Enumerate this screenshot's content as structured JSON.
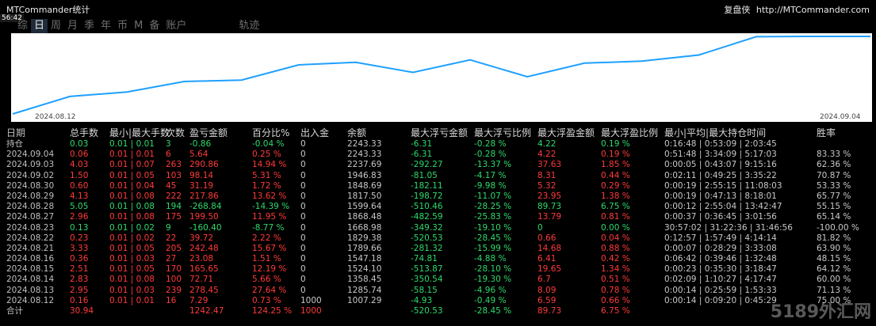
{
  "app_title": "MTCommander统计",
  "brand_name": "复盘侠",
  "brand_url": "http://MTCommander.com",
  "clock": "56:42",
  "tabs": [
    "综",
    "日",
    "周",
    "月",
    "季",
    "年",
    "币",
    "M",
    "备",
    "账户",
    "轨迹"
  ],
  "active_tab": "日",
  "chart": {
    "x_start_label": "2024.08.12",
    "x_end_label": "2024.09.04",
    "line_color": "#1fa0ff",
    "balances": [
      1007.29,
      1285.74,
      1358.45,
      1524.1,
      1547.18,
      1789.66,
      1829.38,
      1668.98,
      1868.48,
      1599.64,
      1817.5,
      1848.69,
      1946.83,
      2237.69,
      2243.33,
      2243.33
    ]
  },
  "table": {
    "headers": [
      "日期",
      "总手数",
      "最小|最大手数",
      "次数",
      "盈亏金额",
      "百分比%",
      "出入金",
      "余额",
      "最大浮亏金额",
      "最大浮亏比例",
      "最大浮盈金额",
      "最大浮盈比例",
      "最小|平均|最大持仓时间",
      "胜率"
    ],
    "rows": [
      {
        "date": "持仓",
        "total": "0.03",
        "minmax": "0.01 | 0.01",
        "count": "3",
        "pl": "-0.86",
        "pct": "-0.04 %",
        "io": "0",
        "bal": "2243.33",
        "mfl": "-6.31",
        "mflp": "-0.28 %",
        "mfp": "4.22",
        "mfpp": "0.19 %",
        "hold": "0:16:48 | 0:53:09 | 2:03:45",
        "win": "",
        "cls": "g"
      },
      {
        "date": "2024.09.04",
        "total": "0.06",
        "minmax": "0.01 | 0.01",
        "count": "6",
        "pl": "5.64",
        "pct": "0.25 %",
        "io": "0",
        "bal": "2243.33",
        "mfl": "-6.31",
        "mflp": "-0.28 %",
        "mfp": "4.22",
        "mfpp": "0.19 %",
        "hold": "0:51:48 | 3:34:09 | 5:17:03",
        "win": "83.33 %",
        "cls": "r"
      },
      {
        "date": "2024.09.03",
        "total": "4.03",
        "minmax": "0.01 | 0.07",
        "count": "263",
        "pl": "290.86",
        "pct": "14.94 %",
        "io": "0",
        "bal": "2237.69",
        "mfl": "-292.27",
        "mflp": "-13.37 %",
        "mfp": "37.63",
        "mfpp": "1.85 %",
        "hold": "0:00:05 | 0:43:07 | 9:15:16",
        "win": "62.36 %",
        "cls": "r"
      },
      {
        "date": "2024.09.02",
        "total": "1.50",
        "minmax": "0.01 | 0.05",
        "count": "103",
        "pl": "98.14",
        "pct": "5.31 %",
        "io": "0",
        "bal": "1946.83",
        "mfl": "-81.05",
        "mflp": "-4.17 %",
        "mfp": "8.31",
        "mfpp": "0.44 %",
        "hold": "0:02:11 | 0:49:25 | 3:35:22",
        "win": "70.87 %",
        "cls": "r"
      },
      {
        "date": "2024.08.30",
        "total": "0.60",
        "minmax": "0.01 | 0.04",
        "count": "45",
        "pl": "31.19",
        "pct": "1.72 %",
        "io": "0",
        "bal": "1848.69",
        "mfl": "-182.11",
        "mflp": "-9.98 %",
        "mfp": "5.32",
        "mfpp": "0.29 %",
        "hold": "0:00:19 | 2:55:15 | 11:08:03",
        "win": "53.33 %",
        "cls": "r"
      },
      {
        "date": "2024.08.29",
        "total": "4.13",
        "minmax": "0.01 | 0.08",
        "count": "222",
        "pl": "217.86",
        "pct": "13.62 %",
        "io": "0",
        "bal": "1817.50",
        "mfl": "-198.72",
        "mflp": "-11.07 %",
        "mfp": "23.95",
        "mfpp": "1.38 %",
        "hold": "0:00:19 | 0:47:13 | 8:18:01",
        "win": "65.77 %",
        "cls": "r"
      },
      {
        "date": "2024.08.28",
        "total": "5.05",
        "minmax": "0.01 | 0.08",
        "count": "194",
        "pl": "-268.84",
        "pct": "-14.39 %",
        "io": "0",
        "bal": "1599.64",
        "mfl": "-510.46",
        "mflp": "-28.25 %",
        "mfp": "89.73",
        "mfpp": "6.75 %",
        "hold": "0:00:12 | 2:55:04 | 13:42:47",
        "win": "55.15 %",
        "cls": "g"
      },
      {
        "date": "2024.08.27",
        "total": "2.96",
        "minmax": "0.01 | 0.08",
        "count": "175",
        "pl": "199.50",
        "pct": "11.95 %",
        "io": "0",
        "bal": "1868.48",
        "mfl": "-482.59",
        "mflp": "-25.83 %",
        "mfp": "13.79",
        "mfpp": "0.81 %",
        "hold": "0:00:37 | 0:36:45 | 3:01:56",
        "win": "65.14 %",
        "cls": "r"
      },
      {
        "date": "2024.08.23",
        "total": "0.13",
        "minmax": "0.01 | 0.02",
        "count": "9",
        "pl": "-160.40",
        "pct": "-8.77 %",
        "io": "0",
        "bal": "1668.98",
        "mfl": "-349.32",
        "mflp": "-19.10 %",
        "mfp": "0",
        "mfpp": "0.00 %",
        "hold": "30:57:02 | 31:22:36 | 31:46:56",
        "win": "-100.00 %",
        "cls": "g"
      },
      {
        "date": "2024.08.22",
        "total": "0.23",
        "minmax": "0.01 | 0.02",
        "count": "22",
        "pl": "39.72",
        "pct": "2.22 %",
        "io": "0",
        "bal": "1829.38",
        "mfl": "-520.53",
        "mflp": "-28.45 %",
        "mfp": "0.66",
        "mfpp": "0.04 %",
        "hold": "0:12:57 | 1:57:49 | 4:14:14",
        "win": "81.82 %",
        "cls": "r"
      },
      {
        "date": "2024.08.21",
        "total": "3.33",
        "minmax": "0.01 | 0.05",
        "count": "205",
        "pl": "242.48",
        "pct": "15.67 %",
        "io": "0",
        "bal": "1789.66",
        "mfl": "-281.32",
        "mflp": "-15.99 %",
        "mfp": "14.68",
        "mfpp": "0.88 %",
        "hold": "0:00:07 | 0:28:29 | 3:33:08",
        "win": "63.90 %",
        "cls": "r"
      },
      {
        "date": "2024.08.16",
        "total": "0.36",
        "minmax": "0.01 | 0.03",
        "count": "27",
        "pl": "23.08",
        "pct": "1.51 %",
        "io": "0",
        "bal": "1547.18",
        "mfl": "-74.81",
        "mflp": "-4.88 %",
        "mfp": "6.41",
        "mfpp": "0.42 %",
        "hold": "0:06:42 | 0:39:46 | 1:32:48",
        "win": "48.15 %",
        "cls": "r"
      },
      {
        "date": "2024.08.15",
        "total": "2.51",
        "minmax": "0.01 | 0.05",
        "count": "170",
        "pl": "165.65",
        "pct": "12.19 %",
        "io": "0",
        "bal": "1524.10",
        "mfl": "-513.87",
        "mflp": "-28.10 %",
        "mfp": "19.65",
        "mfpp": "1.34 %",
        "hold": "0:00:23 | 0:35:30 | 3:18:47",
        "win": "64.12 %",
        "cls": "r"
      },
      {
        "date": "2024.08.14",
        "total": "2.83",
        "minmax": "0.01 | 0.08",
        "count": "100",
        "pl": "72.71",
        "pct": "5.66 %",
        "io": "0",
        "bal": "1358.45",
        "mfl": "-350.54",
        "mflp": "-19.30 %",
        "mfp": "6.7",
        "mfpp": "0.51 %",
        "hold": "0:02:09 | 1:10:27 | 4:17:47",
        "win": "60.00 %",
        "cls": "r"
      },
      {
        "date": "2024.08.13",
        "total": "2.95",
        "minmax": "0.01 | 0.03",
        "count": "239",
        "pl": "278.45",
        "pct": "27.64 %",
        "io": "0",
        "bal": "1285.74",
        "mfl": "-58.15",
        "mflp": "-4.96 %",
        "mfp": "8.09",
        "mfpp": "0.78 %",
        "hold": "0:00:14 | 0:25:59 | 1:53:33",
        "win": "71.13 %",
        "cls": "r"
      },
      {
        "date": "2024.08.12",
        "total": "0.16",
        "minmax": "0.01 | 0.01",
        "count": "16",
        "pl": "7.29",
        "pct": "0.73 %",
        "io": "1000",
        "bal": "1007.29",
        "mfl": "-4.93",
        "mflp": "-0.49 %",
        "mfp": "6.59",
        "mfpp": "0.66 %",
        "hold": "0:00:14 | 0:09:20 | 0:45:29",
        "win": "75.00 %",
        "cls": "r"
      }
    ],
    "total": {
      "label": "合计",
      "total": "30.94",
      "pl": "1242.47",
      "pct": "124.25 %",
      "io": "1000",
      "mfl": "-520.53",
      "mflp": "-28.45 %",
      "mfp": "89.73",
      "mfpp": "6.75 %"
    }
  },
  "watermark": "5189外汇网"
}
